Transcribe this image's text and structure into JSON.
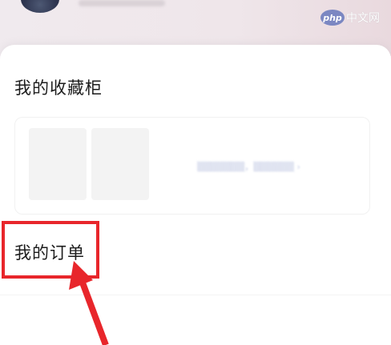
{
  "header": {
    "watermark_logo": "php",
    "watermark_text": "中文网"
  },
  "collection": {
    "title": "我的收藏柜"
  },
  "orders": {
    "title": "我的订单"
  },
  "colors": {
    "highlight": "#e8262b",
    "accent_arrow": "#e8262b"
  }
}
